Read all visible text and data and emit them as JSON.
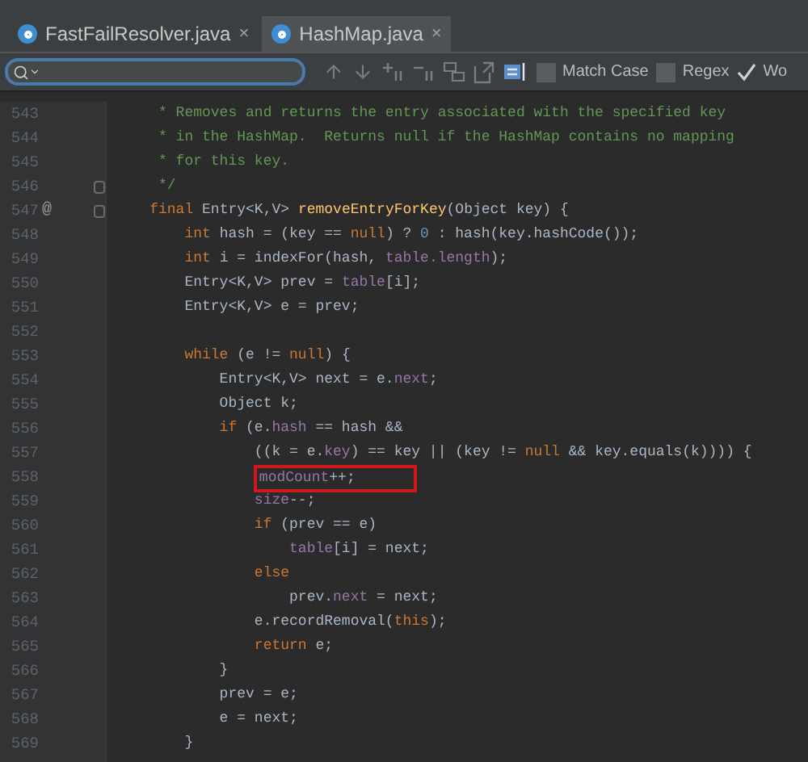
{
  "tabs": [
    {
      "label": "FastFailResolver.java",
      "close": "×",
      "selected": false
    },
    {
      "label": "HashMap.java",
      "close": "×",
      "selected": true
    }
  ],
  "find_bar": {
    "options": [
      {
        "label": "Match Case",
        "checked": false
      },
      {
        "label": "Regex",
        "checked": false
      },
      {
        "label": "Wo",
        "checked": true
      }
    ]
  },
  "editor": {
    "lines": [
      {
        "number": "543",
        "tokens": [
          {
            "kind": "comment",
            "text": "     * Removes and returns the entry associated with the specified key"
          }
        ]
      },
      {
        "number": "544",
        "tokens": [
          {
            "kind": "comment",
            "text": "     * in the HashMap.  Returns null if the HashMap contains no mapping"
          }
        ]
      },
      {
        "number": "545",
        "tokens": [
          {
            "kind": "comment",
            "text": "     * for this key."
          }
        ]
      },
      {
        "number": "546",
        "fold": true,
        "tokens": [
          {
            "kind": "comment",
            "text": "     */"
          }
        ]
      },
      {
        "number": "547",
        "fold": true,
        "override_mark": "@",
        "tokens": [
          {
            "kind": "keyword",
            "text": "    final "
          },
          {
            "kind": "plain",
            "text": "Entry<K,V> "
          },
          {
            "kind": "method",
            "text": "removeEntryForKey"
          },
          {
            "kind": "plain",
            "text": "(Object key) {"
          }
        ]
      },
      {
        "number": "548",
        "tokens": [
          {
            "kind": "keyword",
            "text": "        int "
          },
          {
            "kind": "plain",
            "text": "hash = (key == "
          },
          {
            "kind": "keyword",
            "text": "null"
          },
          {
            "kind": "plain",
            "text": ") ? "
          },
          {
            "kind": "number",
            "text": "0"
          },
          {
            "kind": "plain",
            "text": " : hash(key.hashCode());"
          }
        ]
      },
      {
        "number": "549",
        "tokens": [
          {
            "kind": "keyword",
            "text": "        int "
          },
          {
            "kind": "plain",
            "text": "i = indexFor(hash, "
          },
          {
            "kind": "field",
            "text": "table.length"
          },
          {
            "kind": "plain",
            "text": ");"
          }
        ]
      },
      {
        "number": "550",
        "tokens": [
          {
            "kind": "plain",
            "text": "        Entry<K,V> prev = "
          },
          {
            "kind": "field",
            "text": "table"
          },
          {
            "kind": "plain",
            "text": "[i];"
          }
        ]
      },
      {
        "number": "551",
        "tokens": [
          {
            "kind": "plain",
            "text": "        Entry<K,V> e = prev;"
          }
        ]
      },
      {
        "number": "552"
      },
      {
        "number": "553",
        "tokens": [
          {
            "kind": "keyword",
            "text": "        while "
          },
          {
            "kind": "plain",
            "text": "(e != "
          },
          {
            "kind": "keyword",
            "text": "null"
          },
          {
            "kind": "plain",
            "text": ") {"
          }
        ]
      },
      {
        "number": "554",
        "tokens": [
          {
            "kind": "plain",
            "text": "            Entry<K,V> next = e."
          },
          {
            "kind": "field",
            "text": "next"
          },
          {
            "kind": "plain",
            "text": ";"
          }
        ]
      },
      {
        "number": "555",
        "tokens": [
          {
            "kind": "plain",
            "text": "            Object k;"
          }
        ]
      },
      {
        "number": "556",
        "tokens": [
          {
            "kind": "keyword",
            "text": "            if "
          },
          {
            "kind": "plain",
            "text": "(e."
          },
          {
            "kind": "field",
            "text": "hash"
          },
          {
            "kind": "plain",
            "text": " == hash &&"
          }
        ]
      },
      {
        "number": "557",
        "tokens": [
          {
            "kind": "plain",
            "text": "                ((k = e."
          },
          {
            "kind": "field",
            "text": "key"
          },
          {
            "kind": "plain",
            "text": ") == key || (key != "
          },
          {
            "kind": "keyword",
            "text": "null"
          },
          {
            "kind": "plain",
            "text": " && key.equals(k)))) {"
          }
        ]
      },
      {
        "number": "558",
        "highlighted": true,
        "tokens": [
          {
            "kind": "field",
            "text": "                modCount"
          },
          {
            "kind": "plain",
            "text": "++;"
          }
        ]
      },
      {
        "number": "559",
        "tokens": [
          {
            "kind": "field",
            "text": "                size"
          },
          {
            "kind": "plain",
            "text": "--;"
          }
        ]
      },
      {
        "number": "560",
        "tokens": [
          {
            "kind": "keyword",
            "text": "                if "
          },
          {
            "kind": "plain",
            "text": "(prev == e)"
          }
        ]
      },
      {
        "number": "561",
        "tokens": [
          {
            "kind": "field",
            "text": "                    table"
          },
          {
            "kind": "plain",
            "text": "[i] = next;"
          }
        ]
      },
      {
        "number": "562",
        "tokens": [
          {
            "kind": "keyword",
            "text": "                else"
          }
        ]
      },
      {
        "number": "563",
        "tokens": [
          {
            "kind": "plain",
            "text": "                    prev."
          },
          {
            "kind": "field",
            "text": "next"
          },
          {
            "kind": "plain",
            "text": " = next;"
          }
        ]
      },
      {
        "number": "564",
        "tokens": [
          {
            "kind": "plain",
            "text": "                e.recordRemoval("
          },
          {
            "kind": "keyword",
            "text": "this"
          },
          {
            "kind": "plain",
            "text": ");"
          }
        ]
      },
      {
        "number": "565",
        "tokens": [
          {
            "kind": "keyword",
            "text": "                return "
          },
          {
            "kind": "plain",
            "text": "e;"
          }
        ]
      },
      {
        "number": "566",
        "tokens": [
          {
            "kind": "plain",
            "text": "            }"
          }
        ]
      },
      {
        "number": "567",
        "tokens": [
          {
            "kind": "plain",
            "text": "            prev = e;"
          }
        ]
      },
      {
        "number": "568",
        "tokens": [
          {
            "kind": "plain",
            "text": "            e = next;"
          }
        ]
      },
      {
        "number": "569",
        "tokens": [
          {
            "kind": "plain",
            "text": "        }"
          }
        ]
      }
    ]
  }
}
